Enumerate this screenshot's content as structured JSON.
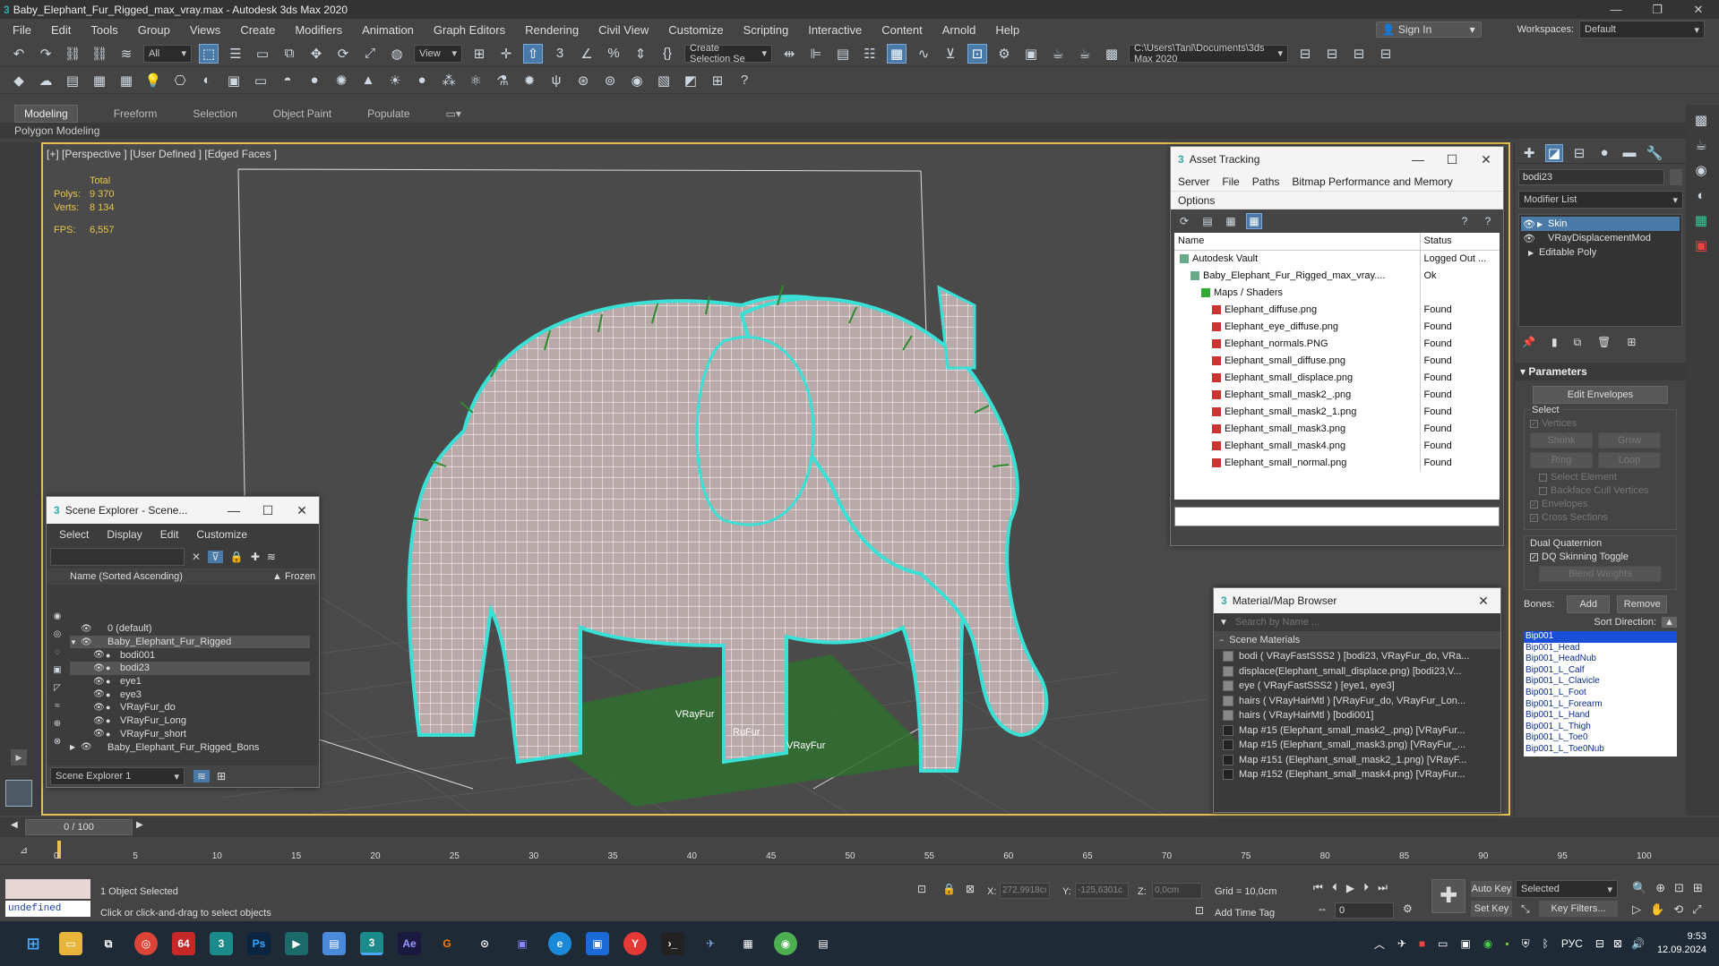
{
  "window": {
    "title": "Baby_Elephant_Fur_Rigged_max_vray.max - Autodesk 3ds Max 2020"
  },
  "menu": [
    "File",
    "Edit",
    "Tools",
    "Group",
    "Views",
    "Create",
    "Modifiers",
    "Animation",
    "Graph Editors",
    "Rendering",
    "Civil View",
    "Customize",
    "Scripting",
    "Interactive",
    "Content",
    "Arnold",
    "Help"
  ],
  "account": {
    "sign_in": "Sign In",
    "workspaces_label": "Workspaces:",
    "workspace_value": "Default"
  },
  "toolbar": {
    "filter_value": "All",
    "refcoord_value": "View",
    "selection_set": "Create Selection Se",
    "project_path": "C:\\Users\\Tani\\Documents\\3ds Max 2020",
    "snap_label": "3"
  },
  "ribbon": {
    "tabs": [
      "Modeling",
      "Freeform",
      "Selection",
      "Object Paint",
      "Populate"
    ],
    "sub_label": "Polygon Modeling"
  },
  "viewport": {
    "label": "[+] [Perspective ] [User Defined ] [Edged Faces ]",
    "stats_header": "Total",
    "polys_label": "Polys:",
    "polys_value": "9 370",
    "verts_label": "Verts:",
    "verts_value": "8 134",
    "fps_label": "FPS:",
    "fps_value": "6,557",
    "fur_labels": [
      "VRayFur",
      "RuFur",
      "VRayFur"
    ]
  },
  "asset_tracking": {
    "title": "Asset Tracking",
    "menu": [
      "Server",
      "File",
      "Paths",
      "Bitmap Performance and Memory"
    ],
    "menu2": "Options",
    "col_name": "Name",
    "col_status": "Status",
    "rows": [
      {
        "name": "Autodesk Vault",
        "status": "Logged Out ...",
        "indent": 0
      },
      {
        "name": "Baby_Elephant_Fur_Rigged_max_vray....",
        "status": "Ok",
        "indent": 1
      },
      {
        "name": "Maps / Shaders",
        "status": "",
        "indent": 2
      },
      {
        "name": "Elephant_diffuse.png",
        "status": "Found",
        "indent": 3
      },
      {
        "name": "Elephant_eye_diffuse.png",
        "status": "Found",
        "indent": 3
      },
      {
        "name": "Elephant_normals.PNG",
        "status": "Found",
        "indent": 3
      },
      {
        "name": "Elephant_small_diffuse.png",
        "status": "Found",
        "indent": 3
      },
      {
        "name": "Elephant_small_displace.png",
        "status": "Found",
        "indent": 3
      },
      {
        "name": "Elephant_small_mask2_.png",
        "status": "Found",
        "indent": 3
      },
      {
        "name": "Elephant_small_mask2_1.png",
        "status": "Found",
        "indent": 3
      },
      {
        "name": "Elephant_small_mask3.png",
        "status": "Found",
        "indent": 3
      },
      {
        "name": "Elephant_small_mask4.png",
        "status": "Found",
        "indent": 3
      },
      {
        "name": "Elephant_small_normal.png",
        "status": "Found",
        "indent": 3
      }
    ]
  },
  "scene_explorer": {
    "title": "Scene Explorer - Scene...",
    "menu": [
      "Select",
      "Display",
      "Edit",
      "Customize"
    ],
    "col_name": "Name (Sorted Ascending)",
    "col_frozen": "▲ Frozen",
    "rows": [
      {
        "name": "0 (default)",
        "indent": 0,
        "selected": false
      },
      {
        "name": "Baby_Elephant_Fur_Rigged",
        "indent": 0,
        "selected": true
      },
      {
        "name": "bodi001",
        "indent": 1,
        "selected": false
      },
      {
        "name": "bodi23",
        "indent": 1,
        "selected": true
      },
      {
        "name": "eye1",
        "indent": 1,
        "selected": false
      },
      {
        "name": "eye3",
        "indent": 1,
        "selected": false
      },
      {
        "name": "VRayFur_do",
        "indent": 1,
        "selected": false
      },
      {
        "name": "VRayFur_Long",
        "indent": 1,
        "selected": false
      },
      {
        "name": "VRayFur_short",
        "indent": 1,
        "selected": false
      },
      {
        "name": "Baby_Elephant_Fur_Rigged_Bons",
        "indent": 0,
        "selected": false
      }
    ],
    "footer": "Scene Explorer 1"
  },
  "material_browser": {
    "title": "Material/Map Browser",
    "search_placeholder": "Search by Name ...",
    "group": "Scene Materials",
    "items": [
      "bodi  ( VRayFastSSS2 ) [bodi23, VRayFur_do, VRa...",
      "displace(Elephant_small_displace.png) [bodi23,V...",
      "eye  ( VRayFastSSS2 ) [eye1, eye3]",
      "hairs  ( VRayHairMtl ) [VRayFur_do, VRayFur_Lon...",
      "hairs  ( VRayHairMtl ) [bodi001]",
      "Map #15 (Elephant_small_mask2_.png) [VRayFur...",
      "Map #15 (Elephant_small_mask3.png) [VRayFur_...",
      "Map #151 (Elephant_small_mask2_1.png) [VRayF...",
      "Map #152 (Elephant_small_mask4.png) [VRayFur..."
    ]
  },
  "command_panel": {
    "object_name": "bodi23",
    "modifier_list": "Modifier List",
    "stack": [
      "Skin",
      "VRayDisplacementMod",
      "Editable Poly"
    ],
    "parameters": "Parameters",
    "edit_envelopes": "Edit Envelopes",
    "select_label": "Select",
    "vertices": "Vertices",
    "shrink": "Shrink",
    "grow": "Grow",
    "ring": "Ring",
    "loop": "Loop",
    "select_element": "Select Element",
    "backface": "Backface Cull Vertices",
    "envelopes": "Envelopes",
    "cross_sections": "Cross Sections",
    "dual_quaternion": "Dual Quaternion",
    "dq_toggle": "DQ Skinning Toggle",
    "blend_weights": "Blend Weights",
    "bones_label": "Bones:",
    "add": "Add",
    "remove": "Remove",
    "sort_direction": "Sort Direction:",
    "bones": [
      "Bip001",
      "Bip001_Head",
      "Bip001_HeadNub",
      "Bip001_L_Calf",
      "Bip001_L_Clavicle",
      "Bip001_L_Foot",
      "Bip001_L_Forearm",
      "Bip001_L_Hand",
      "Bip001_L_Thigh",
      "Bip001_L_Toe0",
      "Bip001_L_Toe0Nub"
    ]
  },
  "timeline": {
    "frame_display": "0 / 100",
    "ticks": [
      "0",
      "5",
      "10",
      "15",
      "20",
      "25",
      "30",
      "35",
      "40",
      "45",
      "50",
      "55",
      "60",
      "65",
      "70",
      "75",
      "80",
      "85",
      "90",
      "95",
      "100"
    ]
  },
  "status": {
    "maxscript": "undefined",
    "selected": "1 Object Selected",
    "prompt": "Click or click-and-drag to select objects",
    "x_label": "X:",
    "x_value": "272,9918cı",
    "y_label": "Y:",
    "y_value": "-125,6301c",
    "z_label": "Z:",
    "z_value": "0,0cm",
    "grid": "Grid = 10,0cm",
    "add_time_tag": "Add Time Tag",
    "auto_key": "Auto Key",
    "set_key": "Set Key",
    "key_mode": "Selected",
    "key_filters": "Key Filters...",
    "frame": "0"
  },
  "taskbar": {
    "lang": "РУС",
    "time": "9:53",
    "date": "12.09.2024"
  },
  "colors": {
    "accent": "#e8c050",
    "selection": "#4a7ba8",
    "wire": "#ffffff",
    "fur": "#2e8b2e",
    "highlight": "#39e0d6"
  }
}
